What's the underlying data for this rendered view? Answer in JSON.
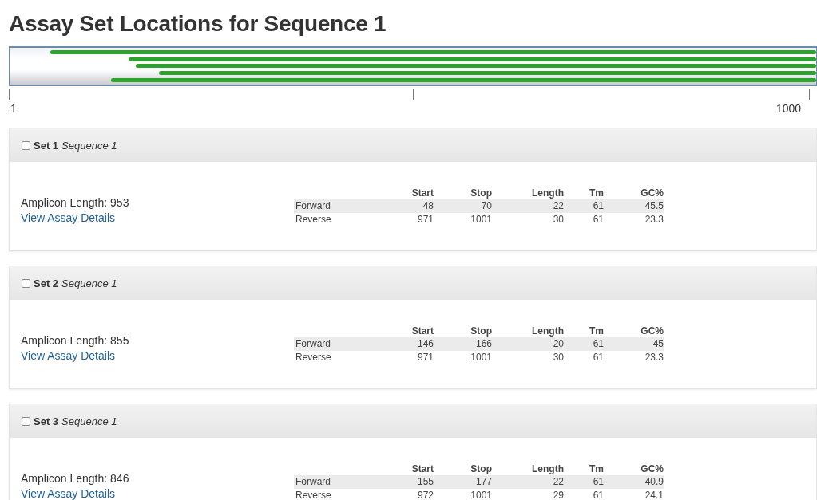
{
  "title": "Assay Set Locations for Sequence 1",
  "map": {
    "tracks": [
      {
        "level": 0.95
      },
      {
        "level": 0.852
      },
      {
        "level": 0.844
      },
      {
        "level": 0.815
      },
      {
        "level": 0.874
      }
    ],
    "ticks": [
      "1",
      "1000"
    ]
  },
  "sets": [
    {
      "name": "Set 1",
      "sequence": "Sequence 1",
      "checked": false,
      "amplicon": "Amplicon Length: 953",
      "link": "View Assay Details",
      "columns": [
        "Start",
        "Stop",
        "Length",
        "Tm",
        "GC%"
      ],
      "primers": [
        {
          "label": "Forward",
          "values": [
            "48",
            "70",
            "22",
            "61",
            "45.5"
          ]
        },
        {
          "label": "Reverse",
          "values": [
            "971",
            "1001",
            "30",
            "61",
            "23.3"
          ]
        }
      ]
    },
    {
      "name": "Set 2",
      "sequence": "Sequence 1",
      "checked": false,
      "amplicon": "Amplicon Length: 855",
      "link": "View Assay Details",
      "columns": [
        "Start",
        "Stop",
        "Length",
        "Tm",
        "GC%"
      ],
      "primers": [
        {
          "label": "Forward",
          "values": [
            "146",
            "166",
            "20",
            "61",
            "45"
          ]
        },
        {
          "label": "Reverse",
          "values": [
            "971",
            "1001",
            "30",
            "61",
            "23.3"
          ]
        }
      ]
    },
    {
      "name": "Set 3",
      "sequence": "Sequence 1",
      "checked": false,
      "amplicon": "Amplicon Length: 846",
      "link": "View Assay Details",
      "columns": [
        "Start",
        "Stop",
        "Length",
        "Tm",
        "GC%"
      ],
      "primers": [
        {
          "label": "Forward",
          "values": [
            "155",
            "177",
            "22",
            "61",
            "40.9"
          ]
        },
        {
          "label": "Reverse",
          "values": [
            "972",
            "1001",
            "29",
            "61",
            "24.1"
          ]
        }
      ]
    }
  ]
}
